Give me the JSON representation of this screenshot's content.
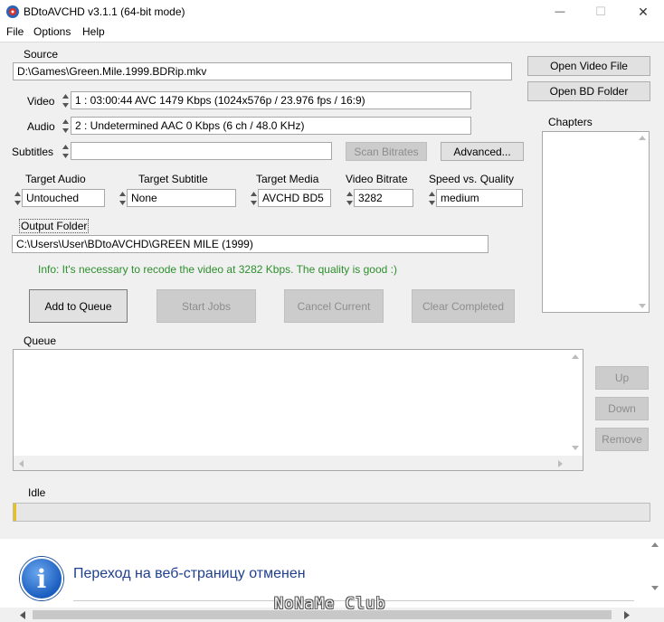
{
  "window": {
    "title": "BDtoAVCHD v3.1.1   (64-bit mode)",
    "minimize_glyph": "—",
    "maximize_glyph": "☐",
    "close_glyph": "✕"
  },
  "menu": {
    "file": "File",
    "options": "Options",
    "help": "Help"
  },
  "source": {
    "label": "Source",
    "path": "D:\\Games\\Green.Mile.1999.BDRip.mkv",
    "open_video_button": "Open Video File",
    "open_bd_button": "Open BD Folder"
  },
  "video": {
    "label": "Video",
    "value": "1 :  03:00:44  AVC  1479 Kbps  (1024x576p / 23.976 fps / 16:9)"
  },
  "audio": {
    "label": "Audio",
    "value": "2 :  Undetermined  AAC  0 Kbps  (6 ch / 48.0 KHz)"
  },
  "subtitles": {
    "label": "Subtitles",
    "value": "",
    "scan_button": "Scan Bitrates",
    "advanced_button": "Advanced..."
  },
  "chapters": {
    "label": "Chapters"
  },
  "targets": {
    "audio_label": "Target Audio",
    "audio_value": "Untouched",
    "subtitle_label": "Target Subtitle",
    "subtitle_value": "None",
    "media_label": "Target Media",
    "media_value": "AVCHD BD5",
    "bitrate_label": "Video Bitrate",
    "bitrate_value": "3282",
    "speed_label": "Speed vs. Quality",
    "speed_value": "medium"
  },
  "output": {
    "label": "Output Folder",
    "path": "C:\\Users\\User\\BDtoAVCHD\\GREEN MILE (1999)"
  },
  "info_message": "Info: It's necessary to recode the video at 3282 Kbps. The quality is good :)",
  "actions": {
    "add_to_queue": "Add to Queue",
    "start_jobs": "Start Jobs",
    "cancel_current": "Cancel Current",
    "clear_completed": "Clear Completed"
  },
  "queue": {
    "label": "Queue",
    "up_button": "Up",
    "down_button": "Down",
    "remove_button": "Remove"
  },
  "status": {
    "text": "Idle",
    "progress": 0
  },
  "webpage_notice": {
    "text": "Переход на веб-страницу отменен",
    "icon_glyph": "i"
  },
  "watermark": "NoNaMe Club",
  "colors": {
    "info_green": "#2d8f2d",
    "info_icon_blue": "#1a5ebf",
    "progress_accent": "#e8c21a"
  }
}
